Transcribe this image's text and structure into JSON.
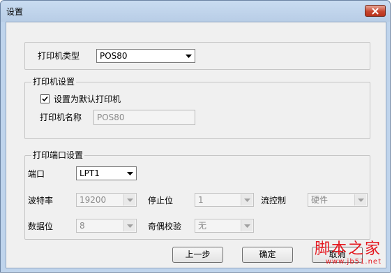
{
  "window": {
    "title": "设置"
  },
  "printer_type": {
    "label": "打印机类型",
    "value": "POS80"
  },
  "printer_settings": {
    "legend": "打印机设置",
    "default_checkbox_label": "设置为默认打印机",
    "default_checked": true,
    "name_label": "打印机名称",
    "name_value": "POS80"
  },
  "port_settings": {
    "legend": "打印端口设置",
    "port_label": "端口",
    "port_value": "LPT1",
    "baud_label": "波特率",
    "baud_value": "19200",
    "stopbits_label": "停止位",
    "stopbits_value": "1",
    "flow_label": "流控制",
    "flow_value": "硬件",
    "databits_label": "数据位",
    "databits_value": "8",
    "parity_label": "奇偶校验",
    "parity_value": "无"
  },
  "buttons": {
    "prev": "上一步",
    "ok": "确定",
    "cancel": "取消"
  },
  "watermark": {
    "main": "脚本之家",
    "sub": "www.jb51.net"
  }
}
